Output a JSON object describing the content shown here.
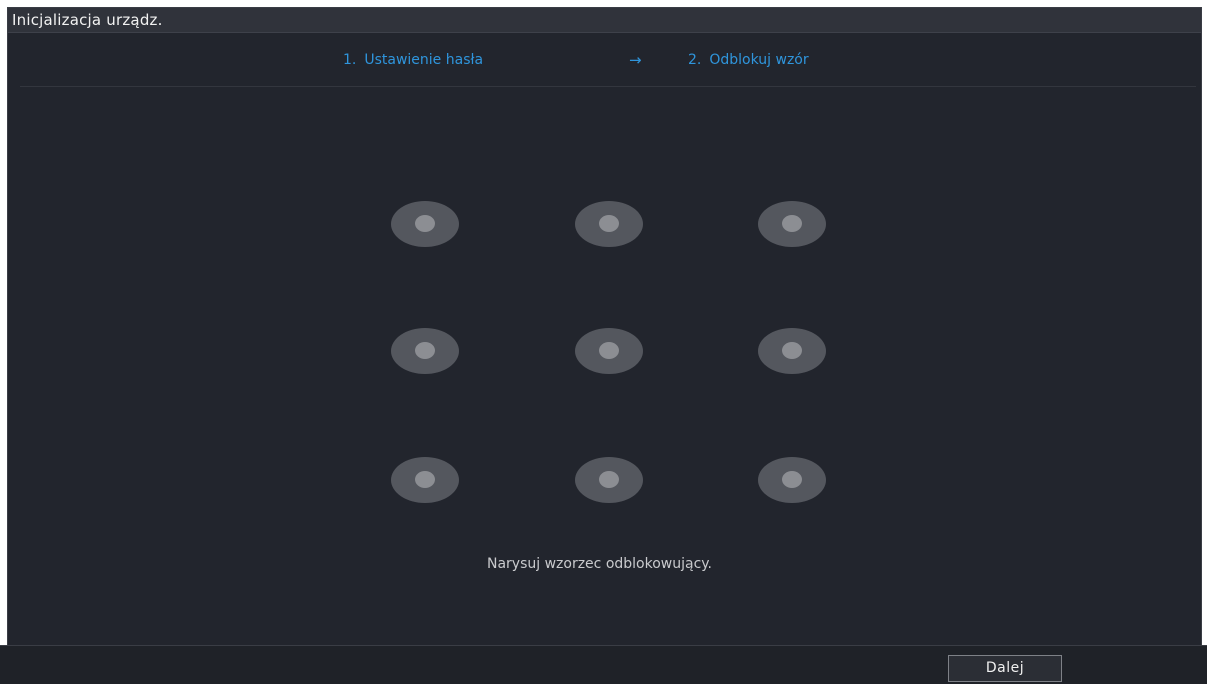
{
  "window": {
    "title": "Inicjalizacja urządz."
  },
  "steps": [
    {
      "number": "1.",
      "label": "Ustawienie hasła"
    },
    {
      "number": "2.",
      "label": "Odblokuj wzór"
    }
  ],
  "step_separator": "→",
  "pattern": {
    "rows": 3,
    "columns": 3,
    "hint": "Narysuj wzorzec odblokowujący."
  },
  "footer": {
    "next_label": "Dalej"
  },
  "colors": {
    "background": "#22252d",
    "titlebar": "#30333b",
    "accent": "#2f95dc",
    "dot_outer": "#54575e",
    "dot_inner": "#8c8e93"
  }
}
